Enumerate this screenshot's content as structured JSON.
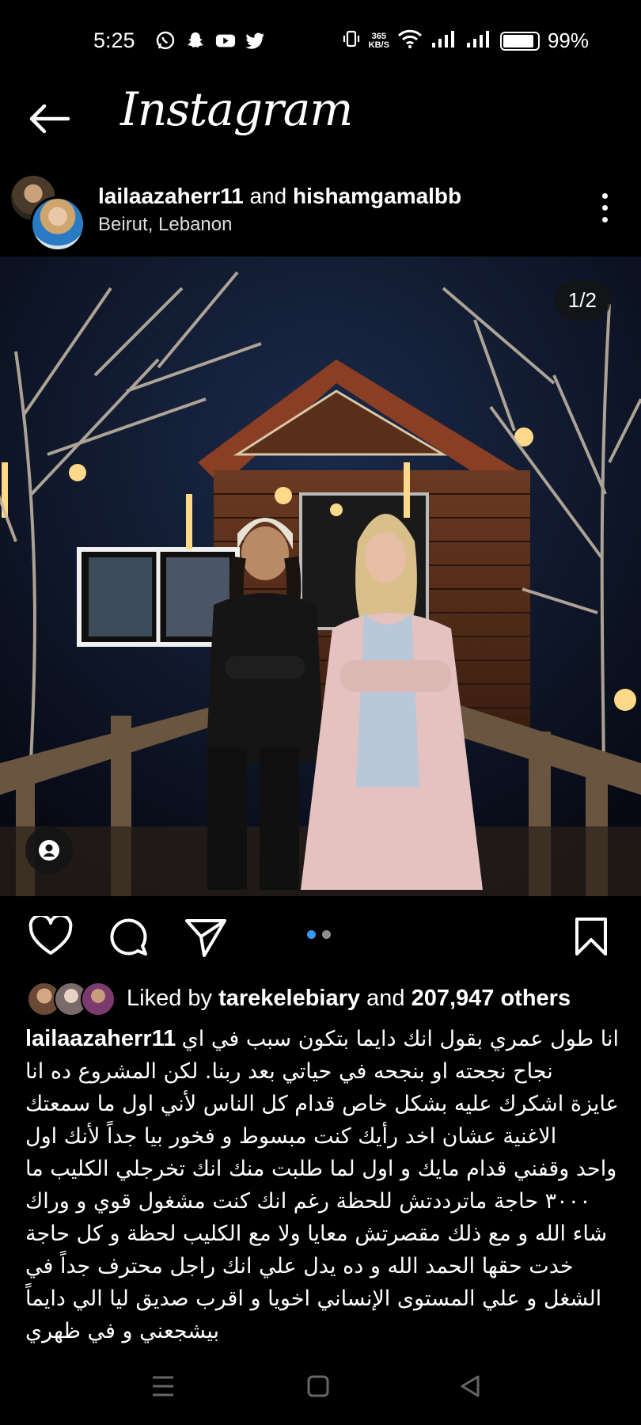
{
  "status_bar": {
    "time": "5:25",
    "net_speed_top": "365",
    "net_speed_bottom": "KB/S",
    "battery": "99%"
  },
  "app": {
    "title": "Instagram"
  },
  "post": {
    "user1": "lailaazaherr11",
    "joiner": "and",
    "user2": "hishamgamalbb",
    "location": "Beirut, Lebanon",
    "image_counter": "1/2",
    "likes": {
      "prefix": "Liked by",
      "user": "tarekelebiary",
      "middle": "and",
      "count": "207,947 others"
    },
    "caption": {
      "username": "lailaazaherr11",
      "lines": [
        "انا طول عمري بقول انك دايما بتكون سبب في اي",
        "نجاح نجحته او بنجحه في حياتي بعد ربنا. لكن المشروع ده انا",
        "عايزة اشكرك عليه بشكل خاص قدام كل الناس لأني اول ما سمعتك",
        "الاغنية عشان اخد رأيك كنت مبسوط و فخور بيا جداً لأنك اول",
        "واحد وقفني قدام مايك و اول لما طلبت منك انك تخرجلي الكليب ما",
        " ٣٠٠٠ حاجة ماترددتش للحظة رغم انك كنت مشغول قوي و وراك",
        "شاء الله و مع ذلك مقصرتش معايا ولا مع الكليب لحظة و كل حاجة",
        "خدت حقها الحمد الله و ده يدل علي انك راجل محترف جداً في",
        "الشغل و علي المستوى الإنساني اخويا و اقرب صديق ليا الي دايماً",
        "بيشجعني و في ظهري"
      ]
    }
  },
  "colors": {
    "background": "#000000",
    "accent_dot": "#3897f0",
    "inactive_dot": "#8e8e8e"
  }
}
